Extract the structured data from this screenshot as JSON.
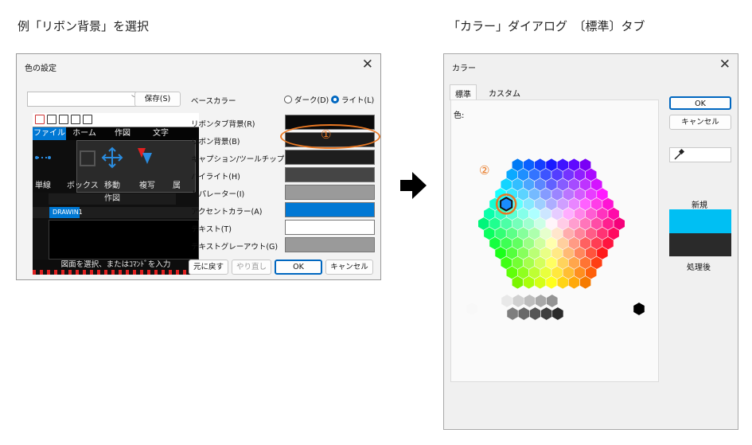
{
  "captions": {
    "left": "例「リボン背景」を選択",
    "right": "「カラー」ダイアログ　〔標準〕タブ"
  },
  "left_dialog": {
    "title": "色の設定",
    "close_glyph": "✕",
    "preset_value": "",
    "save_label": "保存(S)",
    "base_color_label": "ベースカラー",
    "radio_dark": "ダーク(D)",
    "radio_light": "ライト(L)",
    "selected_theme": "light",
    "preview": {
      "tabs": [
        "ファイル",
        "ホーム",
        "作図",
        "文字"
      ],
      "ribbon_labels": [
        "単線",
        "ボックス",
        "移動",
        "複写",
        "属"
      ],
      "group_name": "作図",
      "doc_tab": "DRAWIN1",
      "command_text": "図面を選択、またはｺﾏﾝﾄﾞを入力"
    },
    "rows": [
      {
        "label": "リボンタブ背景(R)",
        "color": "#0a0a0a"
      },
      {
        "label": "リボン背景(B)",
        "color": "#1c1c1c"
      },
      {
        "label": "キャプション/ツールチップ(C)",
        "color": "#1e1e1e"
      },
      {
        "label": "ハイライト(H)",
        "color": "#454545"
      },
      {
        "label": "セパレーター(I)",
        "color": "#9a9a9a"
      },
      {
        "label": "アクセントカラー(A)",
        "color": "#0078d4"
      },
      {
        "label": "テキスト(T)",
        "color": "#ffffff"
      },
      {
        "label": "テキストグレーアウト(G)",
        "color": "#9a9a9a"
      }
    ],
    "marker_1": "①",
    "buttons": {
      "reset": "元に戻す",
      "redo": "やり直し",
      "ok": "OK",
      "cancel": "キャンセル"
    }
  },
  "right_dialog": {
    "title": "カラー",
    "close_glyph": "✕",
    "tabs": [
      "標準",
      "カスタム"
    ],
    "active_tab": "標準",
    "colors_label": "色:",
    "marker_2": "②",
    "ok": "OK",
    "cancel": "キャンセル",
    "new_label": "新規",
    "current_label": "処理後",
    "new_color": "#00bff3",
    "current_color": "#2a2a2a",
    "eyedropper_icon": "eyedropper-icon"
  },
  "colors": {
    "accent": "#0078d4",
    "marker": "#e87722"
  }
}
